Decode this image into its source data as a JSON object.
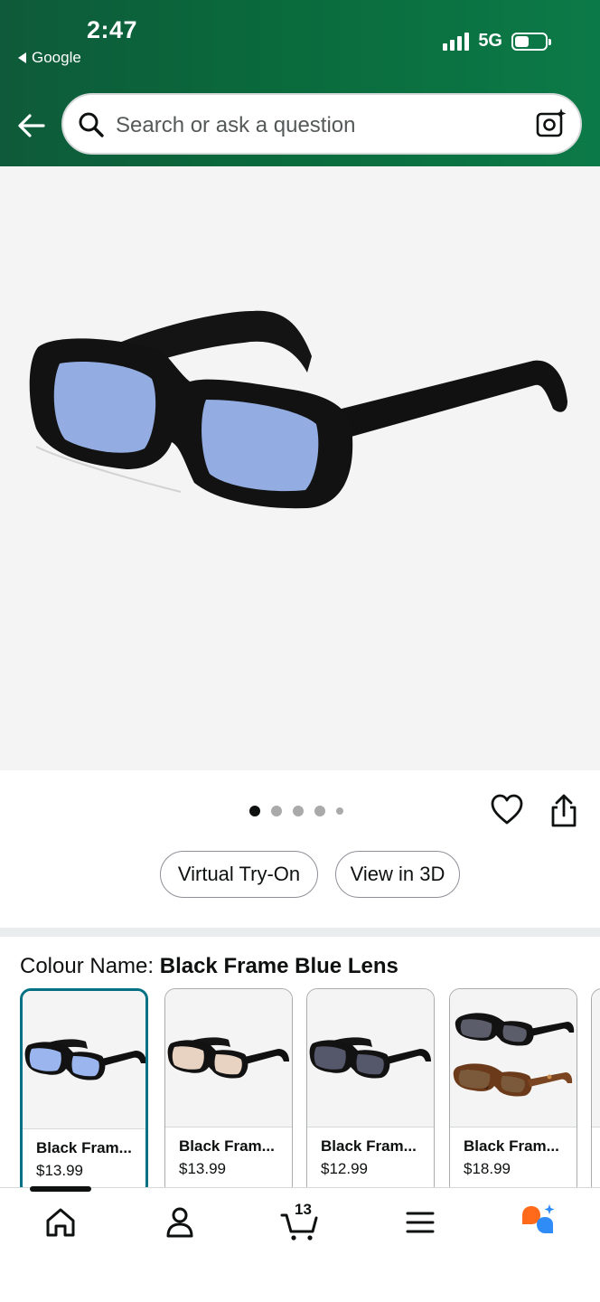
{
  "status_bar": {
    "time": "2:47",
    "back_app": "Google",
    "network": "5G"
  },
  "search": {
    "placeholder": "Search or ask a question"
  },
  "gallery": {
    "image_count": 5,
    "active_index": 0
  },
  "actions": {
    "virtual_try_on": "Virtual Try-On",
    "view_in_3d": "View in 3D"
  },
  "colour": {
    "label": "Colour Name:",
    "value": "Black Frame Blue Lens"
  },
  "variants": [
    {
      "name": "Black Fram...",
      "price": "$13.99",
      "lens_color": "#9bb6ee",
      "selected": true
    },
    {
      "name": "Black Fram...",
      "price": "$13.99",
      "lens_color": "#e8d2c2",
      "selected": false
    },
    {
      "name": "Black Fram...",
      "price": "$12.99",
      "lens_color": "#55576a",
      "selected": false
    },
    {
      "name": "Black Fram...",
      "price": "$18.99",
      "lens_color": "#5c5d6a",
      "selected": false
    }
  ],
  "bottom_nav": {
    "cart_count": "13",
    "items": [
      "home-icon",
      "account-icon",
      "cart-icon",
      "menu-icon",
      "rufus-icon"
    ]
  },
  "colors": {
    "header_green": "#0a6a3c",
    "selected_border": "#007185",
    "lens_blue": "#9bb6ee",
    "rufus_orange": "#ff6a1a",
    "rufus_blue": "#2f8cf7"
  }
}
